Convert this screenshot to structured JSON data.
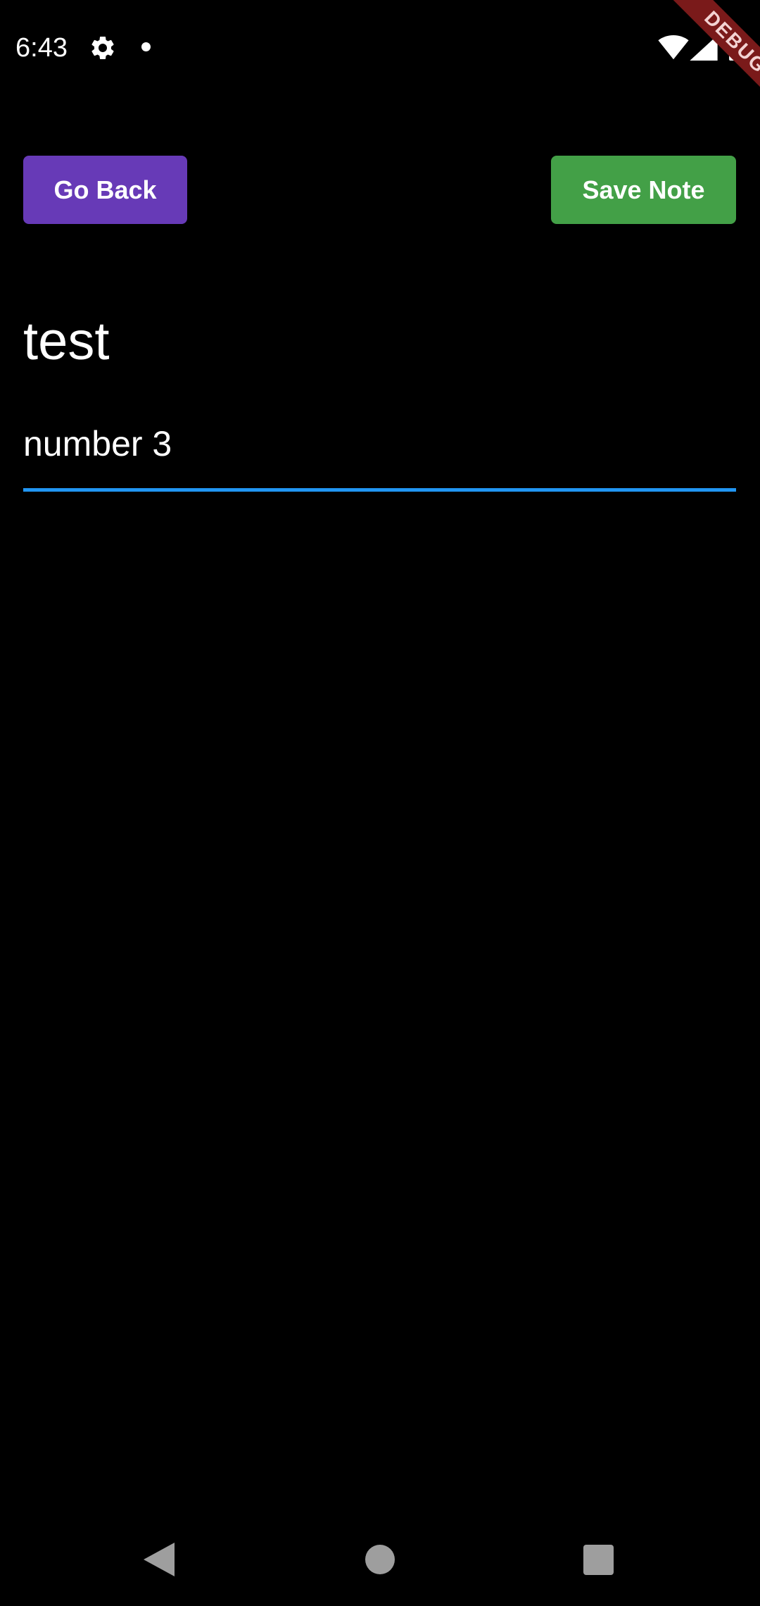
{
  "status_bar": {
    "time": "6:43",
    "icons": [
      "gear-icon",
      "notification-dot-icon",
      "wifi-icon",
      "signal-icon",
      "battery-icon"
    ]
  },
  "debug_banner": {
    "label": "DEBUG",
    "color": "#7a1a1a"
  },
  "toolbar": {
    "back_label": "Go Back",
    "save_label": "Save Note",
    "back_color": "#673ab7",
    "save_color": "#43a047"
  },
  "note": {
    "title": "test",
    "body_value": "number 3",
    "focus_color": "#2196f3"
  },
  "nav_bar": {
    "icons": [
      "nav-back-icon",
      "nav-home-icon",
      "nav-recents-icon"
    ]
  }
}
